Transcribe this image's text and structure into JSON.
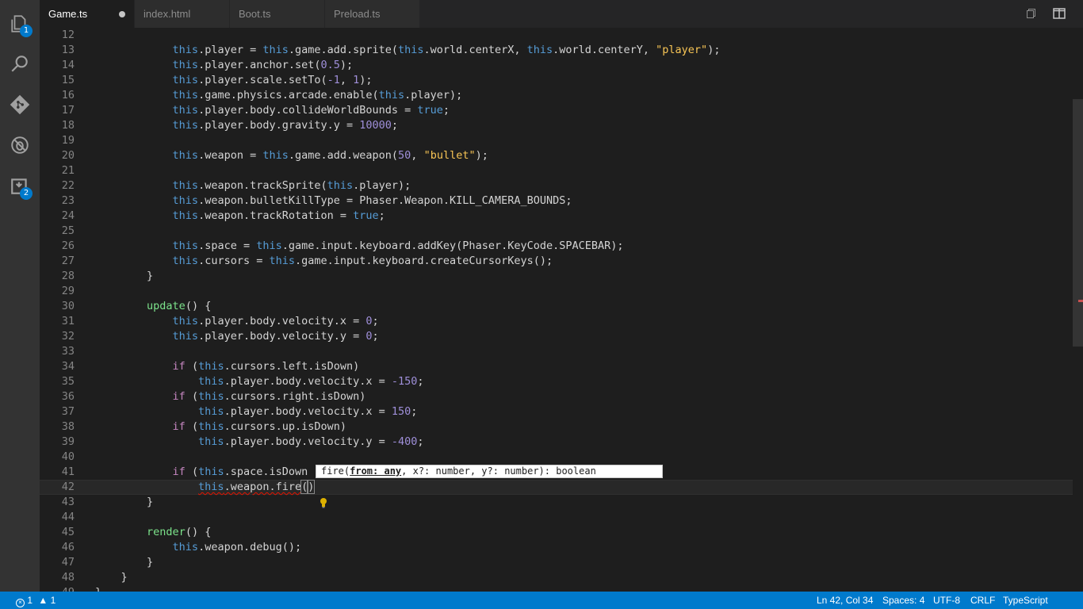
{
  "activity_bar": {
    "explorer_badge": "1",
    "extensions_badge": "2"
  },
  "tabs": [
    {
      "label": "Game.ts",
      "active": true,
      "dirty": true
    },
    {
      "label": "index.html",
      "active": false,
      "dirty": false
    },
    {
      "label": "Boot.ts",
      "active": false,
      "dirty": false
    },
    {
      "label": "Preload.ts",
      "active": false,
      "dirty": false
    }
  ],
  "editor": {
    "current_line": 42,
    "lines": [
      {
        "n": "12",
        "tokens": []
      },
      {
        "n": "13",
        "tokens": [
          [
            "            ",
            "p"
          ],
          [
            "this",
            "th"
          ],
          [
            ".player = ",
            "p"
          ],
          [
            "this",
            "th"
          ],
          [
            ".game.add.sprite(",
            "p"
          ],
          [
            "this",
            "th"
          ],
          [
            ".world.centerX, ",
            "p"
          ],
          [
            "this",
            "th"
          ],
          [
            ".world.centerY, ",
            "p"
          ],
          [
            "\"player\"",
            "s"
          ],
          [
            ");",
            "p"
          ]
        ]
      },
      {
        "n": "14",
        "tokens": [
          [
            "            ",
            "p"
          ],
          [
            "this",
            "th"
          ],
          [
            ".player.anchor.set(",
            "p"
          ],
          [
            "0.5",
            "nv"
          ],
          [
            ");",
            "p"
          ]
        ]
      },
      {
        "n": "15",
        "tokens": [
          [
            "            ",
            "p"
          ],
          [
            "this",
            "th"
          ],
          [
            ".player.scale.setTo(",
            "p"
          ],
          [
            "-1",
            "nv"
          ],
          [
            ", ",
            "p"
          ],
          [
            "1",
            "nv"
          ],
          [
            ");",
            "p"
          ]
        ]
      },
      {
        "n": "16",
        "tokens": [
          [
            "            ",
            "p"
          ],
          [
            "this",
            "th"
          ],
          [
            ".game.physics.arcade.enable(",
            "p"
          ],
          [
            "this",
            "th"
          ],
          [
            ".player);",
            "p"
          ]
        ]
      },
      {
        "n": "17",
        "tokens": [
          [
            "            ",
            "p"
          ],
          [
            "this",
            "th"
          ],
          [
            ".player.body.collideWorldBounds = ",
            "p"
          ],
          [
            "true",
            "th"
          ],
          [
            ";",
            "p"
          ]
        ]
      },
      {
        "n": "18",
        "tokens": [
          [
            "            ",
            "p"
          ],
          [
            "this",
            "th"
          ],
          [
            ".player.body.gravity.y = ",
            "p"
          ],
          [
            "10000",
            "nv"
          ],
          [
            ";",
            "p"
          ]
        ]
      },
      {
        "n": "19",
        "tokens": []
      },
      {
        "n": "20",
        "tokens": [
          [
            "            ",
            "p"
          ],
          [
            "this",
            "th"
          ],
          [
            ".weapon = ",
            "p"
          ],
          [
            "this",
            "th"
          ],
          [
            ".game.add.weapon(",
            "p"
          ],
          [
            "50",
            "nv"
          ],
          [
            ", ",
            "p"
          ],
          [
            "\"bullet\"",
            "s"
          ],
          [
            ");",
            "p"
          ]
        ]
      },
      {
        "n": "21",
        "tokens": []
      },
      {
        "n": "22",
        "tokens": [
          [
            "            ",
            "p"
          ],
          [
            "this",
            "th"
          ],
          [
            ".weapon.trackSprite(",
            "p"
          ],
          [
            "this",
            "th"
          ],
          [
            ".player);",
            "p"
          ]
        ]
      },
      {
        "n": "23",
        "tokens": [
          [
            "            ",
            "p"
          ],
          [
            "this",
            "th"
          ],
          [
            ".weapon.bulletKillType = Phaser.Weapon.KILL_CAMERA_BOUNDS;",
            "p"
          ]
        ]
      },
      {
        "n": "24",
        "tokens": [
          [
            "            ",
            "p"
          ],
          [
            "this",
            "th"
          ],
          [
            ".weapon.trackRotation = ",
            "p"
          ],
          [
            "true",
            "th"
          ],
          [
            ";",
            "p"
          ]
        ]
      },
      {
        "n": "25",
        "tokens": []
      },
      {
        "n": "26",
        "tokens": [
          [
            "            ",
            "p"
          ],
          [
            "this",
            "th"
          ],
          [
            ".space = ",
            "p"
          ],
          [
            "this",
            "th"
          ],
          [
            ".game.input.keyboard.addKey(Phaser.KeyCode.SPACEBAR);",
            "p"
          ]
        ]
      },
      {
        "n": "27",
        "tokens": [
          [
            "            ",
            "p"
          ],
          [
            "this",
            "th"
          ],
          [
            ".cursors = ",
            "p"
          ],
          [
            "this",
            "th"
          ],
          [
            ".game.input.keyboard.createCursorKeys();",
            "p"
          ]
        ]
      },
      {
        "n": "28",
        "tokens": [
          [
            "        }",
            "p"
          ]
        ]
      },
      {
        "n": "29",
        "tokens": []
      },
      {
        "n": "30",
        "tokens": [
          [
            "        ",
            "p"
          ],
          [
            "update",
            "fn"
          ],
          [
            "() {",
            "p"
          ]
        ]
      },
      {
        "n": "31",
        "tokens": [
          [
            "            ",
            "p"
          ],
          [
            "this",
            "th"
          ],
          [
            ".player.body.velocity.x = ",
            "p"
          ],
          [
            "0",
            "nv"
          ],
          [
            ";",
            "p"
          ]
        ]
      },
      {
        "n": "32",
        "tokens": [
          [
            "            ",
            "p"
          ],
          [
            "this",
            "th"
          ],
          [
            ".player.body.velocity.y = ",
            "p"
          ],
          [
            "0",
            "nv"
          ],
          [
            ";",
            "p"
          ]
        ]
      },
      {
        "n": "33",
        "tokens": []
      },
      {
        "n": "34",
        "tokens": [
          [
            "            ",
            "p"
          ],
          [
            "if",
            "kw"
          ],
          [
            " (",
            "p"
          ],
          [
            "this",
            "th"
          ],
          [
            ".cursors.left.isDown)",
            "p"
          ]
        ]
      },
      {
        "n": "35",
        "tokens": [
          [
            "                ",
            "p"
          ],
          [
            "this",
            "th"
          ],
          [
            ".player.body.velocity.x = ",
            "p"
          ],
          [
            "-150",
            "nv"
          ],
          [
            ";",
            "p"
          ]
        ]
      },
      {
        "n": "36",
        "tokens": [
          [
            "            ",
            "p"
          ],
          [
            "if",
            "kw"
          ],
          [
            " (",
            "p"
          ],
          [
            "this",
            "th"
          ],
          [
            ".cursors.right.isDown)",
            "p"
          ]
        ]
      },
      {
        "n": "37",
        "tokens": [
          [
            "                ",
            "p"
          ],
          [
            "this",
            "th"
          ],
          [
            ".player.body.velocity.x = ",
            "p"
          ],
          [
            "150",
            "nv"
          ],
          [
            ";",
            "p"
          ]
        ]
      },
      {
        "n": "38",
        "tokens": [
          [
            "            ",
            "p"
          ],
          [
            "if",
            "kw"
          ],
          [
            " (",
            "p"
          ],
          [
            "this",
            "th"
          ],
          [
            ".cursors.up.isDown)",
            "p"
          ]
        ]
      },
      {
        "n": "39",
        "tokens": [
          [
            "                ",
            "p"
          ],
          [
            "this",
            "th"
          ],
          [
            ".player.body.velocity.y = ",
            "p"
          ],
          [
            "-400",
            "nv"
          ],
          [
            ";",
            "p"
          ]
        ]
      },
      {
        "n": "40",
        "tokens": []
      },
      {
        "n": "41",
        "tokens": [
          [
            "            ",
            "p"
          ],
          [
            "if",
            "kw"
          ],
          [
            " (",
            "p"
          ],
          [
            "this",
            "th"
          ],
          [
            ".space.isDown",
            "p"
          ]
        ]
      },
      {
        "n": "42",
        "tokens": [
          [
            "                ",
            "p"
          ],
          [
            "this",
            "th sq"
          ],
          [
            ".weapon.fire",
            "p sq"
          ],
          [
            "(",
            "p box"
          ],
          [
            ")",
            "p box"
          ]
        ]
      },
      {
        "n": "43",
        "tokens": [
          [
            "        }",
            "p"
          ]
        ]
      },
      {
        "n": "44",
        "tokens": []
      },
      {
        "n": "45",
        "tokens": [
          [
            "        ",
            "p"
          ],
          [
            "render",
            "fn"
          ],
          [
            "() {",
            "p"
          ]
        ]
      },
      {
        "n": "46",
        "tokens": [
          [
            "            ",
            "p"
          ],
          [
            "this",
            "th"
          ],
          [
            ".weapon.debug();",
            "p"
          ]
        ]
      },
      {
        "n": "47",
        "tokens": [
          [
            "        }",
            "p"
          ]
        ]
      },
      {
        "n": "48",
        "tokens": [
          [
            "    }",
            "p"
          ]
        ]
      },
      {
        "n": "49",
        "tokens": [
          [
            "}",
            "p"
          ]
        ]
      }
    ]
  },
  "parameter_hint": {
    "prefix": "fire(",
    "active_param": "from: any",
    "suffix": ", x?: number, y?: number): boolean"
  },
  "status_bar": {
    "errors": "1",
    "warnings": "1",
    "position": "Ln 42, Col 34",
    "indent": "Spaces: 4",
    "encoding": "UTF-8",
    "eol": "CRLF",
    "language": "TypeScript"
  },
  "colors": {
    "accent": "#007acc",
    "keyword_this": "#569cd6",
    "string": "#f8c555",
    "number": "#9f8fd9",
    "control_keyword": "#c586c0",
    "method": "#7ce38b"
  }
}
